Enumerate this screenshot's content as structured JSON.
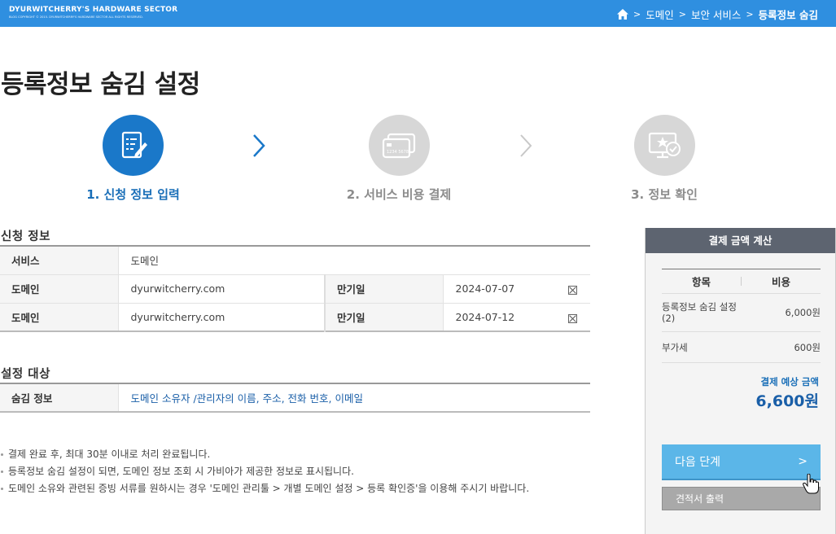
{
  "header": {
    "logo_title": "DYURWITCHERRY'S HARDWARE SECTOR",
    "logo_subtitle": "BLOG COPYRIGHT © 2015. DYURWITCHERRY'S HARDWARE SECTOR ALL RIGHTS RESERVED.",
    "breadcrumb": [
      "도메인",
      "보안 서비스",
      "등록정보 숨김"
    ],
    "breadcrumb_sep": ">",
    "home_icon": "home-icon"
  },
  "page_title": "등록정보 숨김 설정",
  "steps": [
    {
      "label": "1. 신청 정보 입력",
      "icon": "form-edit-icon",
      "active": true
    },
    {
      "label": "2. 서비스 비용 결제",
      "icon": "credit-card-icon",
      "active": false
    },
    {
      "label": "3. 정보 확인",
      "icon": "monitor-check-icon",
      "active": false
    }
  ],
  "application": {
    "title": "신청 정보",
    "service_label": "서비스",
    "service_value": "도메인",
    "rows": [
      {
        "domain_label": "도메인",
        "domain_value": "dyurwitcherry.com",
        "expiry_label": "만기일",
        "expiry_value": "2024-07-07"
      },
      {
        "domain_label": "도메인",
        "domain_value": "dyurwitcherry.com",
        "expiry_label": "만기일",
        "expiry_value": "2024-07-12"
      }
    ]
  },
  "target": {
    "title": "설정 대상",
    "label": "숨김 정보",
    "value": "도메인 소유자 /관리자의 이름, 주소, 전화 번호, 이메일"
  },
  "notes": [
    "결제 완료 후, 최대 30분 이내로 처리 완료됩니다.",
    "등록정보 숨김 설정이 되면, 도메인 정보 조회 시 가비아가 제공한 정보로 표시됩니다.",
    "도메인 소유와 관련된 증빙 서류를 원하시는 경우 '도메인 관리툴 > 개별 도메인 설정 > 등록 확인증'을 이용해 주시기 바랍니다."
  ],
  "side_panel": {
    "title": "결제 금액 계산",
    "col_item": "항목",
    "col_cost": "비용",
    "items": [
      {
        "name": "등록정보 숨김 설정(2)",
        "cost": "6,000원"
      },
      {
        "name": "부가세",
        "cost": "600원"
      }
    ],
    "total_label": "결제 예상 금액",
    "total_value": "6,600원",
    "next_button": "다음 단계",
    "next_chevron": ">",
    "quote_button": "견적서 출력"
  },
  "colors": {
    "header_bg": "#2f8fe0",
    "step_active": "#1a78c9",
    "step_inactive": "#d7d7d7",
    "next_button": "#5bb6e8",
    "panel_head": "#5d6470"
  }
}
